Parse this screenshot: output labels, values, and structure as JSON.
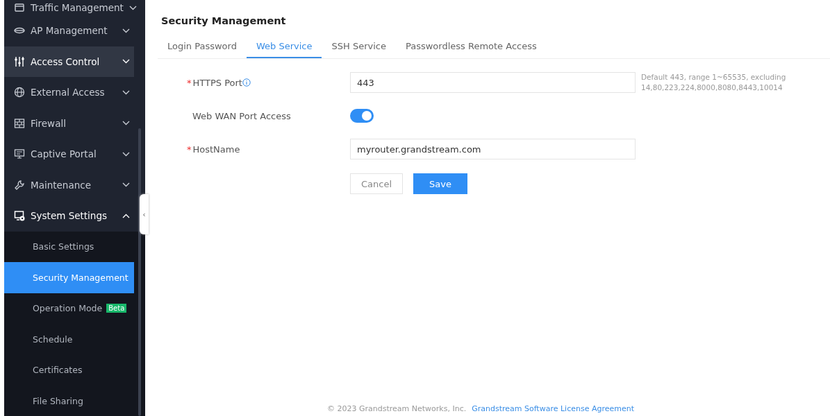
{
  "sidebar": {
    "menu": [
      {
        "label": "Traffic Management",
        "expanded": false,
        "hovered": false
      },
      {
        "label": "AP Management",
        "expanded": false,
        "hovered": false
      },
      {
        "label": "Access Control",
        "expanded": false,
        "hovered": true
      },
      {
        "label": "External Access",
        "expanded": false,
        "hovered": false
      },
      {
        "label": "Firewall",
        "expanded": false,
        "hovered": false
      },
      {
        "label": "Captive Portal",
        "expanded": false,
        "hovered": false
      },
      {
        "label": "Maintenance",
        "expanded": false,
        "hovered": false
      },
      {
        "label": "System Settings",
        "expanded": true,
        "hovered": false,
        "children": [
          {
            "label": "Basic Settings",
            "selected": false
          },
          {
            "label": "Security Management",
            "selected": true
          },
          {
            "label": "Operation Mode",
            "selected": false,
            "badge": "Beta"
          },
          {
            "label": "Schedule",
            "selected": false
          },
          {
            "label": "Certificates",
            "selected": false
          },
          {
            "label": "File Sharing",
            "selected": false
          }
        ]
      }
    ]
  },
  "collapse_handle": {
    "glyph": "‹"
  },
  "page": {
    "title": "Security Management",
    "tabs": [
      {
        "label": "Login Password",
        "selected": false
      },
      {
        "label": "Web Service",
        "selected": true
      },
      {
        "label": "SSH Service",
        "selected": false
      },
      {
        "label": "Passwordless Remote Access",
        "selected": false
      }
    ],
    "form": [
      {
        "kind": "input",
        "label": "HTTPS Port",
        "required_mark": "*",
        "info": true,
        "value": "443",
        "hint": "Default 443, range 1~65535, excluding 14,80,223,224,8000,8080,8443,10014"
      },
      {
        "kind": "switch",
        "label": "Web WAN Port Access",
        "on": true
      },
      {
        "kind": "input",
        "label": "HostName",
        "required_mark": "*",
        "value": "myrouter.grandstream.com"
      }
    ],
    "buttons": [
      {
        "label": "Cancel",
        "primary": false
      },
      {
        "label": "Save",
        "primary": true
      }
    ]
  },
  "footer": {
    "copyright": "© 2023 Grandstream Networks, Inc.",
    "link": "Grandstream Software License Agreement"
  }
}
